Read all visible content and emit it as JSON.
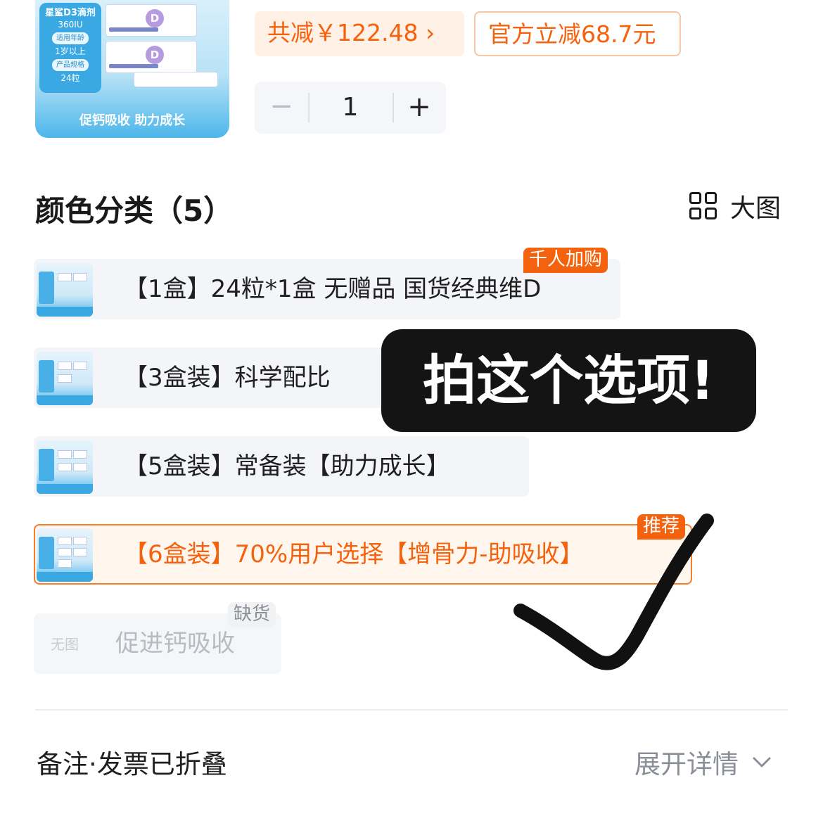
{
  "product": {
    "thumb": {
      "brand": "星鲨D3滴剂",
      "spec": "360IU",
      "age_tag": "适用年龄",
      "age_value": "1岁以上",
      "spec_tag": "产品规格",
      "count": "24粒",
      "d_mark": "D",
      "slogan": "促钙吸收 助力成长"
    },
    "discount_total": "共减￥122.48 ›",
    "discount_official": "官方立减68.7元",
    "stepper": {
      "minus": "−",
      "quantity": "1",
      "plus": "+"
    }
  },
  "section": {
    "title": "颜色分类（5）",
    "big_image_label": "大图"
  },
  "options": [
    {
      "label": "【1盒】24粒*1盒 无赠品 国货经典维D",
      "badge": "千人加购",
      "state": "normal"
    },
    {
      "label": "【3盒装】科学配比",
      "badge": "",
      "state": "normal"
    },
    {
      "label": "【5盒装】常备装【助力成长】",
      "badge": "",
      "state": "normal"
    },
    {
      "label": "【6盒装】70%用户选择【增骨力-助吸收】",
      "badge": "推荐",
      "state": "selected"
    },
    {
      "label": "促进钙吸收",
      "badge": "缺货",
      "no_image": "无图",
      "state": "disabled"
    }
  ],
  "annotation": {
    "note": "拍这个选项!",
    "mark": "check-mark"
  },
  "footer": {
    "remark": "备注·发票已折叠",
    "expand": "展开详情"
  },
  "colors": {
    "accent": "#f5620d",
    "selected_border": "#f57e2a",
    "option_bg": "#f3f5f8",
    "brand_blue": "#3aa9e3"
  }
}
